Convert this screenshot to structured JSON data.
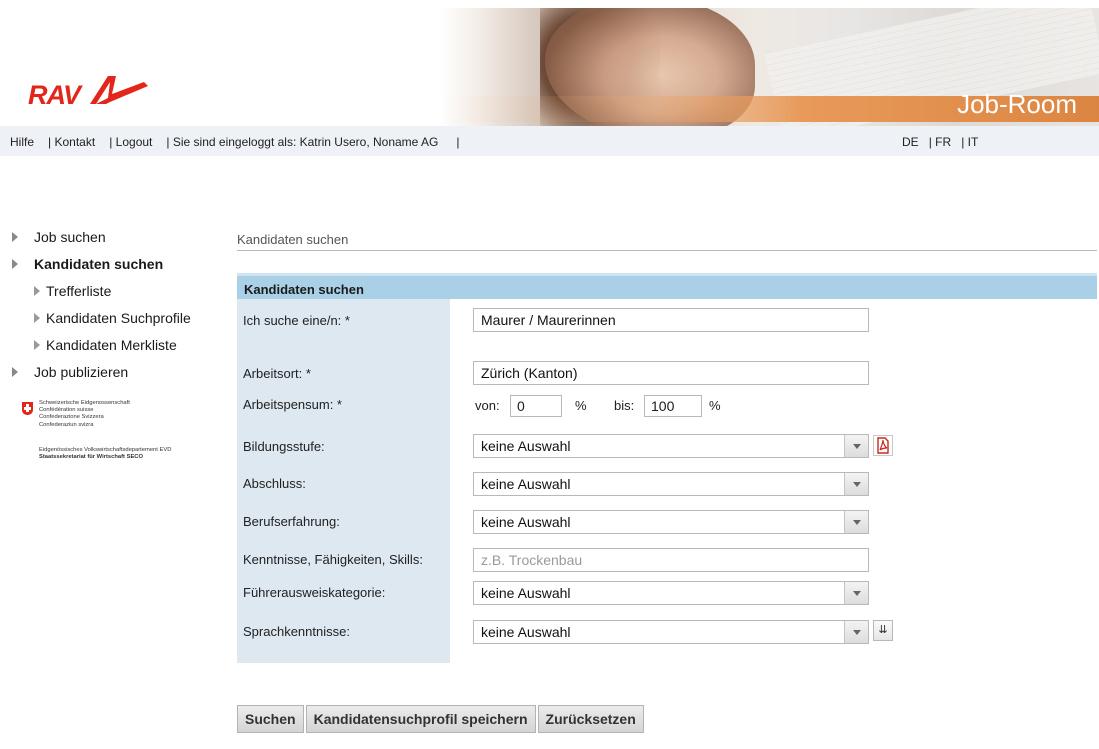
{
  "header": {
    "logo_text": "RAV",
    "brand_title": "Job-Room"
  },
  "topnav": {
    "links": [
      "Hilfe",
      "| Kontakt",
      "| Logout",
      "| Sie sind eingeloggt als: Katrin Usero, Noname AG",
      "|"
    ],
    "languages": [
      "DE",
      "| FR",
      "| IT"
    ]
  },
  "sidebar": {
    "items": [
      {
        "label": "Job suchen"
      },
      {
        "label": "Kandidaten suchen"
      },
      {
        "label": "Trefferliste"
      },
      {
        "label": "Kandidaten Suchprofile"
      },
      {
        "label": "Kandidaten Merkliste"
      },
      {
        "label": "Job publizieren"
      }
    ],
    "seco_lines": [
      "Schweizerische Eidgenossenschaft",
      "Confédération suisse",
      "Confederazione Svizzera",
      "Confederaziun svizra"
    ],
    "seco_dept": "Eidgenössisches Volkswirtschaftsdepartement EVD",
    "seco_office": "Staatssekretariat für Wirtschaft SECO"
  },
  "main": {
    "breadcrumb": "Kandidaten suchen",
    "form_title": "Kandidaten suchen",
    "fields": {
      "job": {
        "label": "Ich suche eine/n: *",
        "value": "Maurer / Maurerinnen"
      },
      "place": {
        "label": "Arbeitsort: *",
        "value": "Zürich (Kanton)"
      },
      "workload": {
        "label": "Arbeitspensum: *",
        "from_label": "von:",
        "from_value": "0",
        "percent": "%",
        "to_label": "bis:",
        "to_value": "100"
      },
      "education": {
        "label": "Bildungsstufe:",
        "value": "keine Auswahl"
      },
      "degree": {
        "label": "Abschluss:",
        "value": "keine Auswahl"
      },
      "experience": {
        "label": "Berufserfahrung:",
        "value": "keine Auswahl"
      },
      "skills": {
        "label": "Kenntnisse, Fähigkeiten, Skills:",
        "placeholder": "z.B. Trockenbau"
      },
      "license": {
        "label": "Führerausweiskategorie:",
        "value": "keine Auswahl"
      },
      "languages": {
        "label": "Sprachkenntnisse:",
        "value": "keine Auswahl"
      }
    },
    "buttons": {
      "search": "Suchen",
      "save_profile": "Kandidatensuchprofil speichern",
      "reset": "Zurücksetzen"
    }
  },
  "colors": {
    "accent": "#e2261c",
    "form_header": "#a9d0e6",
    "label_column": "#dde8f1"
  }
}
